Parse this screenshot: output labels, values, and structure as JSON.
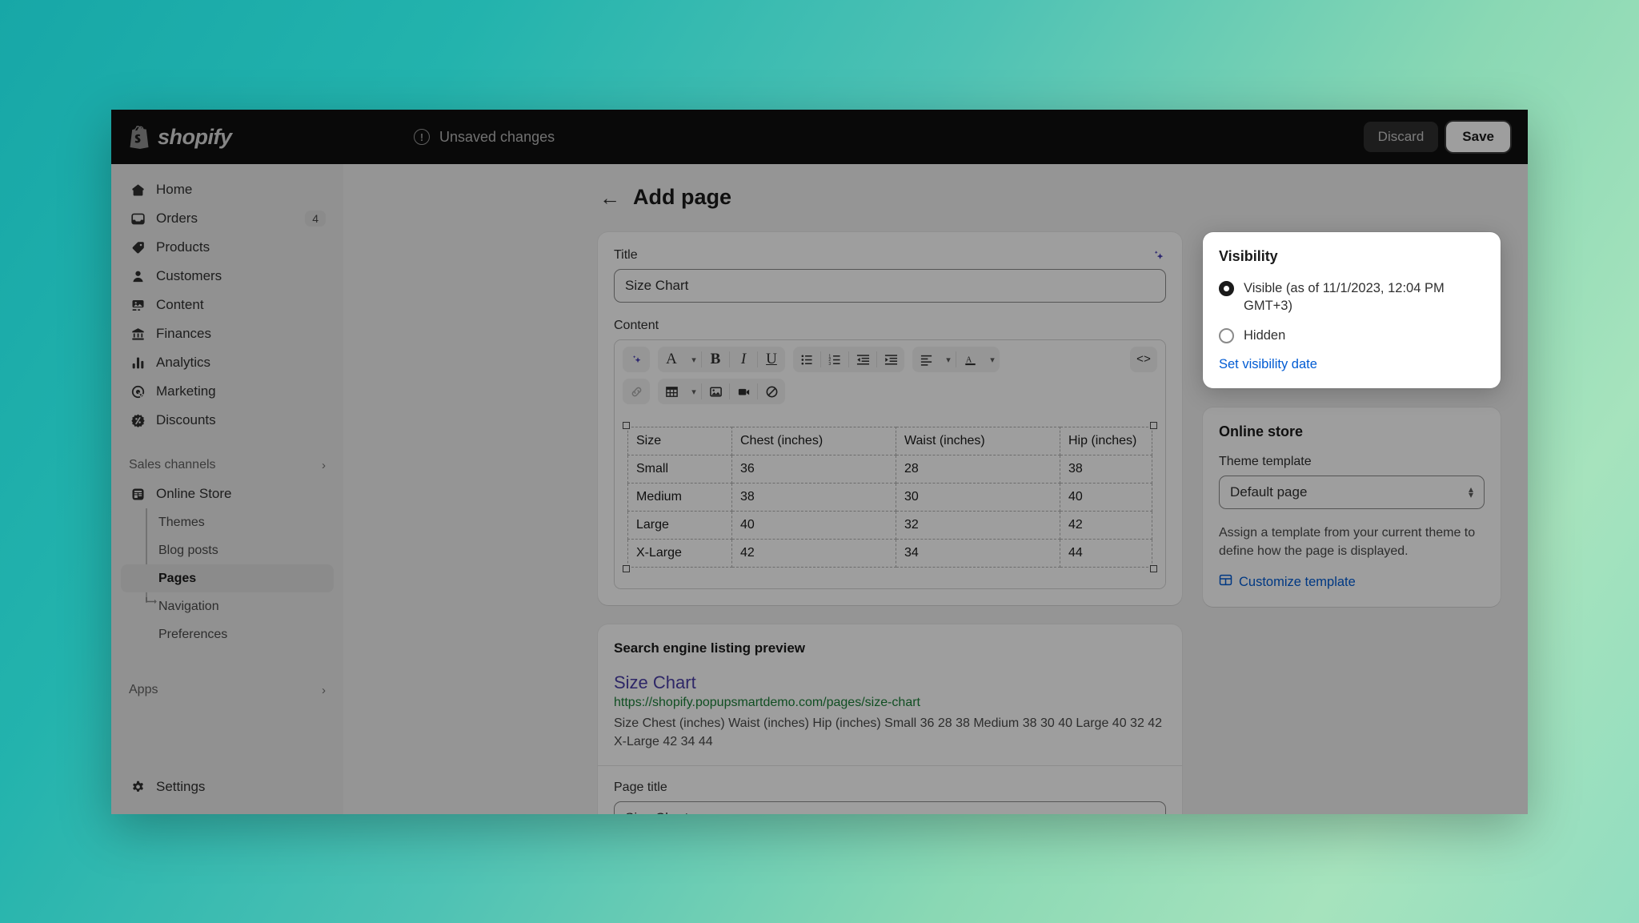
{
  "topbar": {
    "brand": "shopify",
    "brand_icon": "shopify-bag-icon",
    "unsaved_label": "Unsaved changes",
    "unsaved_icon": "alert-circle-icon",
    "discard_label": "Discard",
    "save_label": "Save"
  },
  "sidebar": {
    "items": [
      {
        "label": "Home",
        "icon": "home-icon",
        "badge": ""
      },
      {
        "label": "Orders",
        "icon": "orders-inbox-icon",
        "badge": "4"
      },
      {
        "label": "Products",
        "icon": "product-tag-icon",
        "badge": ""
      },
      {
        "label": "Customers",
        "icon": "person-icon",
        "badge": ""
      },
      {
        "label": "Content",
        "icon": "image-content-icon",
        "badge": ""
      },
      {
        "label": "Finances",
        "icon": "bank-icon",
        "badge": ""
      },
      {
        "label": "Analytics",
        "icon": "bar-chart-icon",
        "badge": ""
      },
      {
        "label": "Marketing",
        "icon": "target-cursor-icon",
        "badge": ""
      },
      {
        "label": "Discounts",
        "icon": "discount-badge-icon",
        "badge": ""
      }
    ],
    "sales_channels_label": "Sales channels",
    "online_store_label": "Online Store",
    "online_store_icon": "storefront-icon",
    "sub_items": [
      {
        "label": "Themes",
        "active": false
      },
      {
        "label": "Blog posts",
        "active": false
      },
      {
        "label": "Pages",
        "active": true
      },
      {
        "label": "Navigation",
        "active": false
      },
      {
        "label": "Preferences",
        "active": false
      }
    ],
    "apps_label": "Apps",
    "settings_label": "Settings",
    "settings_icon": "gear-icon",
    "chevron_icon": "chevron-right-icon"
  },
  "page": {
    "back_icon": "arrow-left-icon",
    "title": "Add page"
  },
  "title_field": {
    "label": "Title",
    "value": "Size Chart",
    "placeholder": "",
    "magic_icon": "ai-sparkle-icon"
  },
  "content_field": {
    "label": "Content",
    "toolbar_row1": [
      {
        "name": "ai-sparkle-button",
        "glyph": "magic"
      },
      {
        "name": "font-style-button",
        "glyph": "A"
      },
      {
        "name": "font-style-chevron",
        "glyph": "chev"
      },
      {
        "name": "bold-button",
        "glyph": "B"
      },
      {
        "name": "italic-button",
        "glyph": "I"
      },
      {
        "name": "underline-button",
        "glyph": "U"
      },
      {
        "name": "bulleted-list-button",
        "glyph": "ul"
      },
      {
        "name": "numbered-list-button",
        "glyph": "ol"
      },
      {
        "name": "outdent-button",
        "glyph": "outdent"
      },
      {
        "name": "indent-button",
        "glyph": "indent"
      },
      {
        "name": "align-button",
        "glyph": "align"
      },
      {
        "name": "align-chevron",
        "glyph": "chev"
      },
      {
        "name": "text-color-button",
        "glyph": "Acolor"
      },
      {
        "name": "text-color-chevron",
        "glyph": "chev"
      },
      {
        "name": "code-view-button",
        "glyph": "<>"
      }
    ],
    "toolbar_row2": [
      {
        "name": "insert-link-button",
        "glyph": "link",
        "disabled": true
      },
      {
        "name": "insert-table-button",
        "glyph": "table"
      },
      {
        "name": "table-chevron",
        "glyph": "chev"
      },
      {
        "name": "insert-image-button",
        "glyph": "image"
      },
      {
        "name": "insert-video-button",
        "glyph": "video"
      },
      {
        "name": "clear-formatting-button",
        "glyph": "noformat"
      }
    ]
  },
  "chart_data": {
    "type": "table",
    "title": "Size Chart",
    "columns": [
      "Size",
      "Chest (inches)",
      "Waist (inches)",
      "Hip (inches)"
    ],
    "rows": [
      [
        "Small",
        "36",
        "28",
        "38"
      ],
      [
        "Medium",
        "38",
        "30",
        "40"
      ],
      [
        "Large",
        "40",
        "32",
        "42"
      ],
      [
        "X-Large",
        "42",
        "34",
        "44"
      ]
    ]
  },
  "seo": {
    "section_label": "Search engine listing preview",
    "title": "Size Chart",
    "url": "https://shopify.popupsmartdemo.com/pages/size-chart",
    "description": "Size Chest (inches) Waist (inches) Hip (inches) Small 36 28 38 Medium 38 30 40 Large 40 32 42 X-Large 42 34 44",
    "page_title_label": "Page title",
    "page_title_value": "Size Chart"
  },
  "visibility": {
    "card_title": "Visibility",
    "options": [
      {
        "label": "Visible (as of 11/1/2023, 12:04 PM GMT+3)",
        "selected": true
      },
      {
        "label": "Hidden",
        "selected": false
      }
    ],
    "set_date_link": "Set visibility date"
  },
  "online_store": {
    "card_title": "Online store",
    "theme_template_label": "Theme template",
    "theme_template_value": "Default page",
    "select_caret_icon": "chevron-updown-icon",
    "help_text": "Assign a template from your current theme to define how the page is displayed.",
    "customize_link": "Customize template",
    "customize_icon": "template-layout-icon"
  },
  "colors": {
    "accent_link": "#005bd3",
    "seo_title": "#4b3fa7",
    "seo_url": "#1a7f37",
    "ai_purple": "#4a3fb5",
    "topbar_bg": "#0f0f0f",
    "sidebar_bg": "#ebebeb"
  }
}
